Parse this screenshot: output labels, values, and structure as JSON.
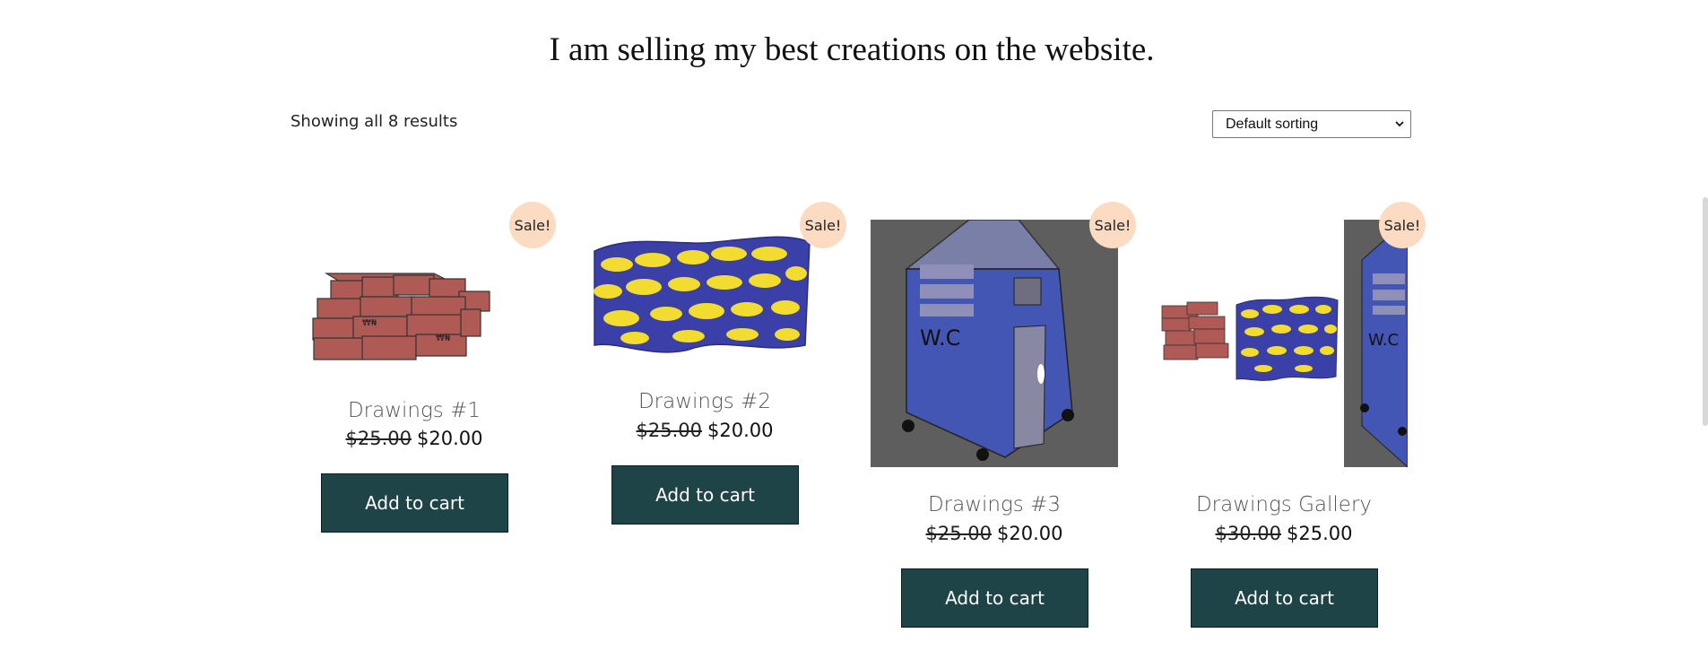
{
  "page": {
    "title": "I am selling my best creations on the website."
  },
  "shop": {
    "results_count": "Showing all 8 results",
    "sort": {
      "selected": "Default sorting"
    }
  },
  "products": [
    {
      "name": "Drawings #1",
      "badge": "Sale!",
      "old_price": "$25.00",
      "price": "$20.00",
      "button": "Add to cart",
      "image": "bricks-stack"
    },
    {
      "name": "Drawings #2",
      "badge": "Sale!",
      "old_price": "$25.00",
      "price": "$20.00",
      "button": "Add to cart",
      "image": "fish-pattern-cloth"
    },
    {
      "name": "Drawings #3",
      "badge": "Sale!",
      "old_price": "$25.00",
      "price": "$20.00",
      "button": "Add to cart",
      "image": "wc-cabin",
      "thumb_text": "W.C"
    },
    {
      "name": "Drawings Gallery",
      "badge": "Sale!",
      "old_price": "$30.00",
      "price": "$25.00",
      "button": "Add to cart",
      "image": "gallery-collage",
      "thumb_text": "W.C"
    }
  ],
  "colors": {
    "button_bg": "#1f4447",
    "badge_bg": "#fbdcc3",
    "brick": "#b05a56",
    "cloth_blue": "#3b3fa8",
    "fish_yellow": "#f2dc2f",
    "cabin_blue": "#4356b4",
    "cabin_bg": "#5e5e5e"
  }
}
